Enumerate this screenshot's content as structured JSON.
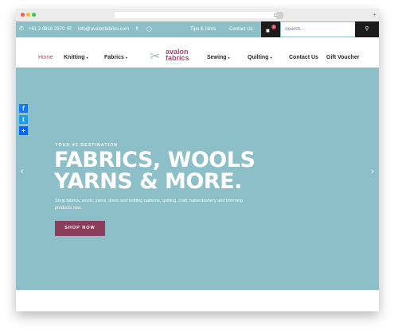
{
  "browser": {
    "reload_glyph": "C"
  },
  "topbar": {
    "phone": "+61 2 9918 2970",
    "email": "info@avalonfabrics.com",
    "tips_link": "Tips & Hints",
    "contact_link": "Contact Us",
    "cart_count": "0",
    "search_placeholder": "Search..."
  },
  "logo": {
    "line1": "avalon",
    "line2": "fabrics",
    "line3": "& CRAFT"
  },
  "nav": {
    "home": "Home",
    "knitting": "Knitting",
    "fabrics": "Fabrics",
    "sewing": "Sewing",
    "quilting": "Quilting",
    "contact": "Contact Us",
    "voucher": "Gift Voucher",
    "caret": "▾"
  },
  "social": {
    "facebook": "f",
    "twitter": "t",
    "share": "+"
  },
  "hero": {
    "eyebrow": "YOUR #1 DESTINATION",
    "headline_line1": "FABRICS, WOOLS",
    "headline_line2": "YARNS & MORE.",
    "description": "Shop fabrics, wools, yarns, dress and knitting patterns, quilting, craft, haberdashery and trimming products now.",
    "cta": "SHOP NOW",
    "prev_arrow": "‹",
    "next_arrow": "›"
  },
  "colors": {
    "teal": "#8cbfc7",
    "brand_pink": "#b0456e",
    "cta": "#8c3c5b",
    "dark": "#1c1c1c"
  },
  "icons": {
    "phone": "phone-icon",
    "email": "envelope-icon",
    "facebook": "facebook-icon",
    "instagram": "instagram-icon",
    "cart": "cart-icon",
    "search": "search-icon"
  }
}
